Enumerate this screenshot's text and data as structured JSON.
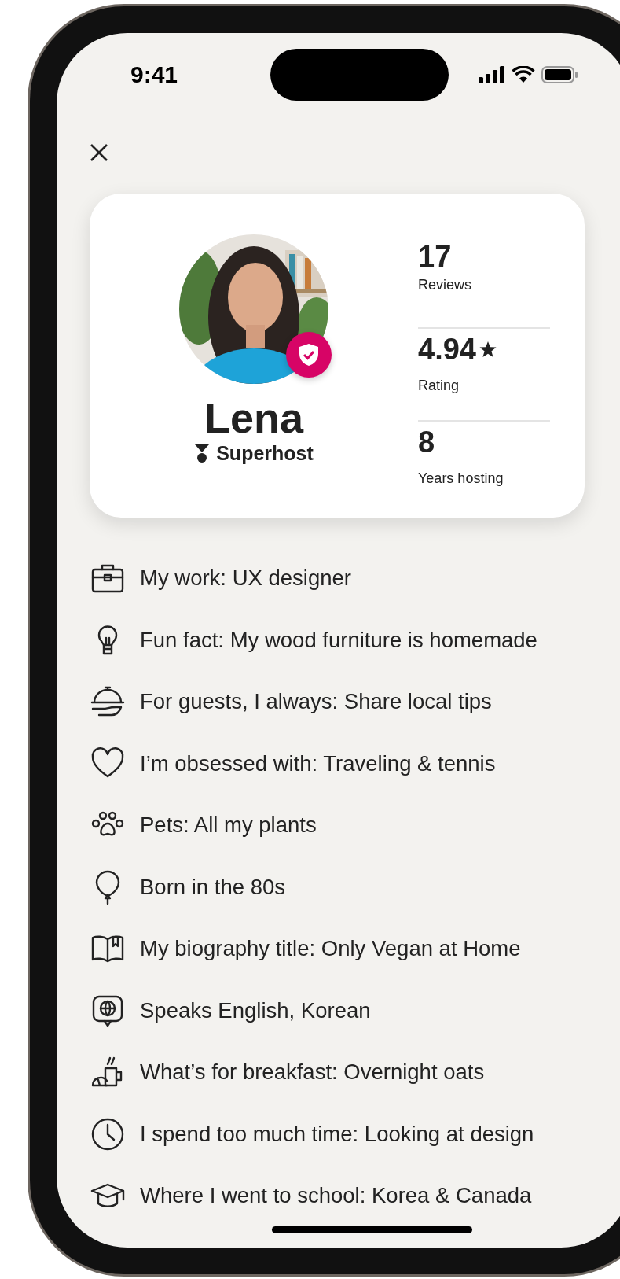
{
  "status_bar": {
    "time": "9:41"
  },
  "profile": {
    "name": "Lena",
    "badge": "Superhost",
    "verified": true,
    "stats": [
      {
        "value": "17",
        "label": "Reviews",
        "star": false
      },
      {
        "value": "4.94",
        "label": "Rating",
        "star": true
      },
      {
        "value": "8",
        "label": "Years hosting",
        "star": false
      }
    ]
  },
  "facts": [
    {
      "kind": "briefcase",
      "text": "My work: UX designer"
    },
    {
      "kind": "bulb",
      "text": "Fun fact: My wood furniture is homemade"
    },
    {
      "kind": "cloche",
      "text": "For guests, I always: Share local tips"
    },
    {
      "kind": "heart",
      "text": "I’m obsessed with: Traveling & tennis"
    },
    {
      "kind": "paw",
      "text": "Pets: All my plants"
    },
    {
      "kind": "balloon",
      "text": "Born in the 80s"
    },
    {
      "kind": "book",
      "text": "My biography title: Only Vegan at Home"
    },
    {
      "kind": "globe",
      "text": "Speaks English, Korean"
    },
    {
      "kind": "breakfast",
      "text": "What’s for breakfast: Overnight oats"
    },
    {
      "kind": "clock",
      "text": "I spend too much time: Looking at design"
    },
    {
      "kind": "cap",
      "text": "Where I went to school: Korea & Canada"
    }
  ]
}
